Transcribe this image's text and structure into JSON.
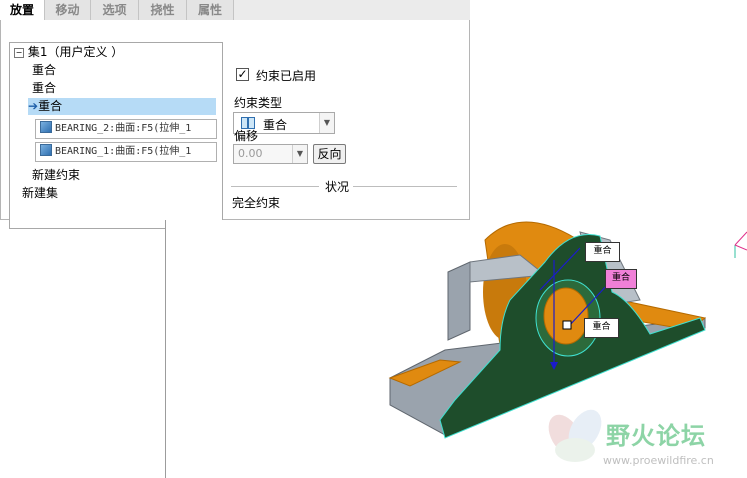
{
  "tabs": [
    {
      "label": "放置",
      "active": true
    },
    {
      "label": "移动",
      "active": false
    },
    {
      "label": "选项",
      "active": false
    },
    {
      "label": "挠性",
      "active": false
    },
    {
      "label": "属性",
      "active": false
    }
  ],
  "tree": {
    "set_label": "集1（用户定义 ）",
    "items": [
      "重合",
      "重合",
      "重合"
    ],
    "refs": [
      "BEARING_2:曲面:F5(拉伸_1",
      "BEARING_1:曲面:F5(拉伸_1"
    ],
    "new_constraint": "新建约束",
    "new_set": "新建集"
  },
  "constraint": {
    "enabled_label": "约束已启用",
    "enabled": true,
    "type_label": "约束类型",
    "type_value": "重合",
    "offset_label": "偏移",
    "offset_value": "0.00",
    "flip_label": "反向"
  },
  "status": {
    "header": "状况",
    "value": "完全约束"
  },
  "model_tags": [
    "重合",
    "重合",
    "重合"
  ],
  "watermark": {
    "name": "野火论坛",
    "url": "www.proewildfire.cn"
  },
  "colors": {
    "body": "#1e4d2b",
    "orange": "#e08a10",
    "gray": "#9aa3ad",
    "selection": "#b6dbf6",
    "magenta": "#f080d8"
  }
}
